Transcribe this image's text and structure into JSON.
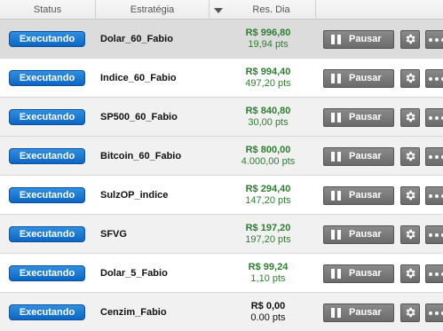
{
  "header": {
    "status": "Status",
    "strategy": "Estratégia",
    "result": "Res. Dia"
  },
  "labels": {
    "pause": "Pausar"
  },
  "rows": [
    {
      "status": "Executando",
      "strategy": "Dolar_60_Fabio",
      "money": "R$ 996,80",
      "pts": "19,94 pts"
    },
    {
      "status": "Executando",
      "strategy": "Indice_60_Fabio",
      "money": "R$ 994,40",
      "pts": "497,20 pts"
    },
    {
      "status": "Executando",
      "strategy": "SP500_60_Fabio",
      "money": "R$ 840,80",
      "pts": "30,00 pts"
    },
    {
      "status": "Executando",
      "strategy": "Bitcoin_60_Fabio",
      "money": "R$ 800,00",
      "pts": "4.000,00 pts"
    },
    {
      "status": "Executando",
      "strategy": "SulzOP_indice",
      "money": "R$ 294,40",
      "pts": "147,20 pts"
    },
    {
      "status": "Executando",
      "strategy": "SFVG",
      "money": "R$ 197,20",
      "pts": "197,20 pts"
    },
    {
      "status": "Executando",
      "strategy": "Dolar_5_Fabio",
      "money": "R$ 99,24",
      "pts": "1,10 pts"
    },
    {
      "status": "Executando",
      "strategy": "Cenzim_Fabio",
      "money": "R$ 0,00",
      "pts": "0.00 pts"
    }
  ],
  "colors": {
    "status_blue": "#1a78d4",
    "profit_green": "#2e7d32",
    "button_gray": "#7a7a7a"
  },
  "icons": {
    "sort": "triangle-down-icon",
    "pause": "pause-icon",
    "settings": "gear-icon",
    "more": "more-dots-icon"
  }
}
